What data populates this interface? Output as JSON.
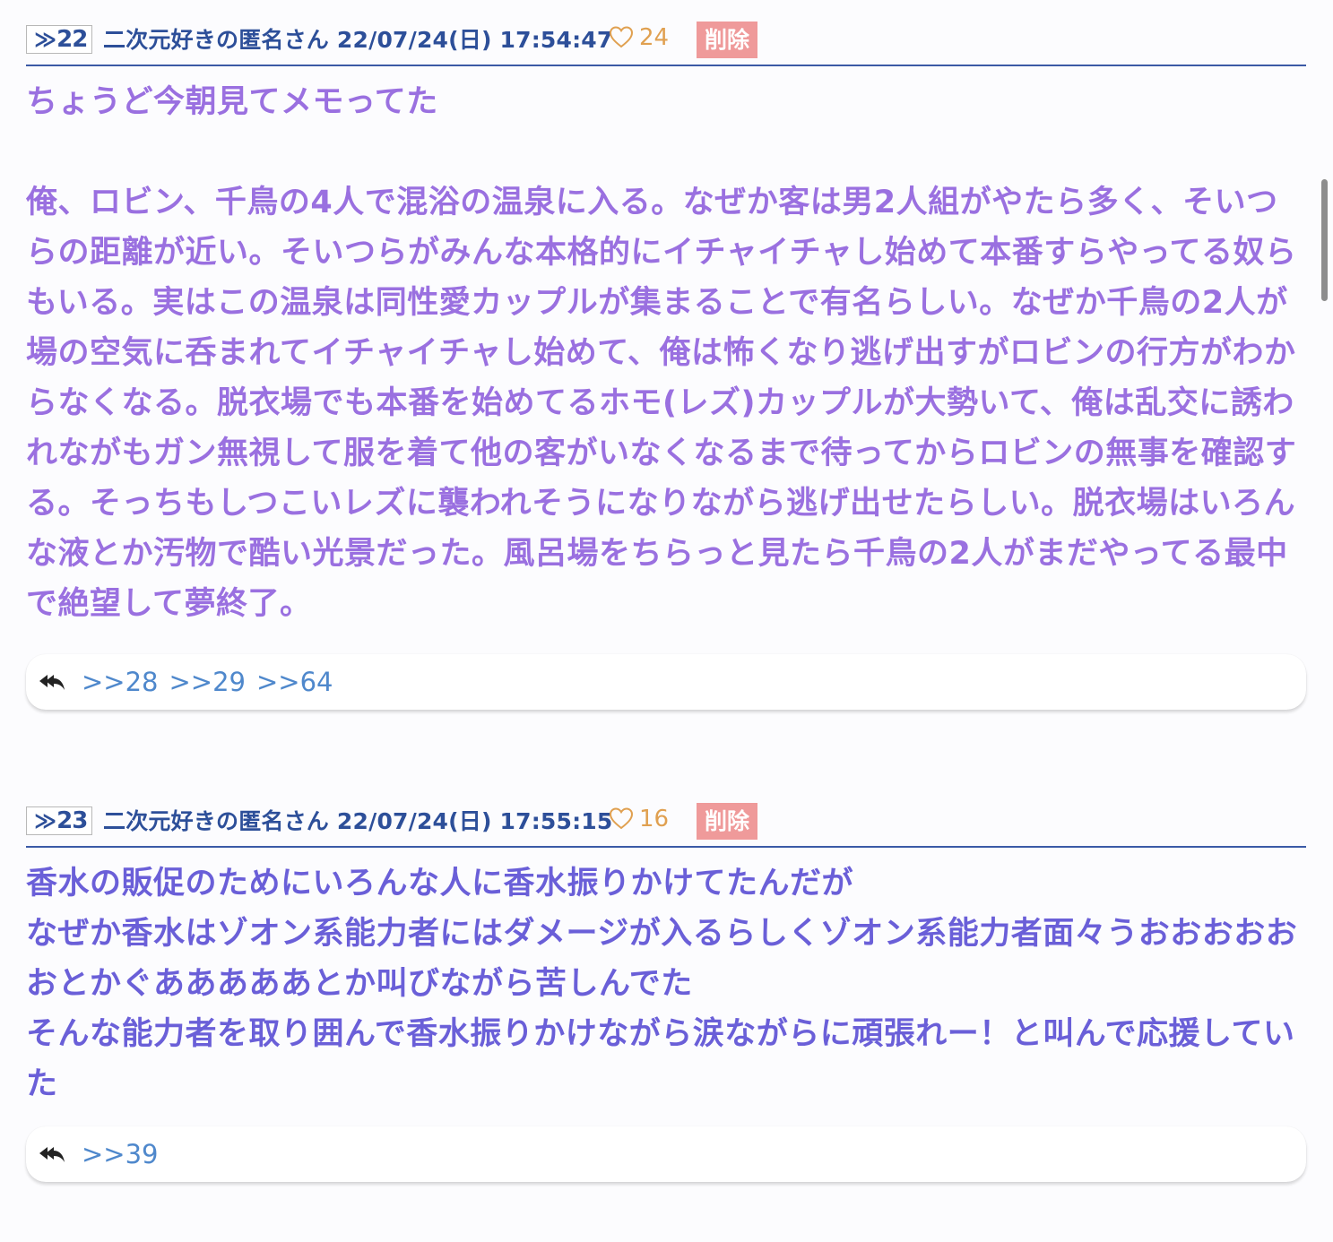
{
  "posts": [
    {
      "res_number": "22",
      "res_arrow": "≫",
      "author": "二次元好きの匿名さん",
      "datetime": "22/07/24(日) 17:54:47",
      "likes": "24",
      "delete_label": "削除",
      "body": "ちょうど今朝見てメモってた\n\n俺、ロビン、千鳥の4人で混浴の温泉に入る。なぜか客は男2人組がやたら多く、そいつらの距離が近い。そいつらがみんな本格的にイチャイチャし始めて本番すらやってる奴らもいる。実はこの温泉は同性愛カップルが集まることで有名らしい。なぜか千鳥の2人が場の空気に呑まれてイチャイチャし始めて、俺は怖くなり逃げ出すがロビンの行方がわからなくなる。脱衣場でも本番を始めてるホモ(レズ)カップルが大勢いて、俺は乱交に誘われながもガン無視して服を着て他の客がいなくなるまで待ってからロビンの無事を確認する。そっちもしつこいレズに襲われそうになりながら逃げ出せたらしい。脱衣場はいろんな液とか汚物で酷い光景だった。風呂場をちらっと見たら千鳥の2人がまだやってる最中で絶望して夢終了。",
      "body_color": "#9a70e0",
      "replies": [
        ">>28",
        ">>29",
        ">>64"
      ]
    },
    {
      "res_number": "23",
      "res_arrow": "≫",
      "author": "二次元好きの匿名さん",
      "datetime": "22/07/24(日) 17:55:15",
      "likes": "16",
      "delete_label": "削除",
      "body": "香水の販促のためにいろんな人に香水振りかけてたんだが\nなぜか香水はゾオン系能力者にはダメージが入るらしくゾオン系能力者面々うおおおおおおとかぐあああああとか叫びながら苦しんでた\nそんな能力者を取り囲んで香水振りかけながら涙ながらに頑張れー！と叫んで応援していた",
      "body_color": "#6a5fd8",
      "replies": [
        ">>39"
      ]
    }
  ],
  "colors": {
    "header_text": "#2d4f99",
    "divider": "#3b5aa6",
    "like": "#e0a050",
    "delete_bg": "#ef9a9a",
    "reply_link": "#4f88cc"
  },
  "icons": {
    "res_arrow": "double-chevron-right-icon",
    "like": "heart-outline-icon",
    "reply": "reply-all-icon"
  }
}
